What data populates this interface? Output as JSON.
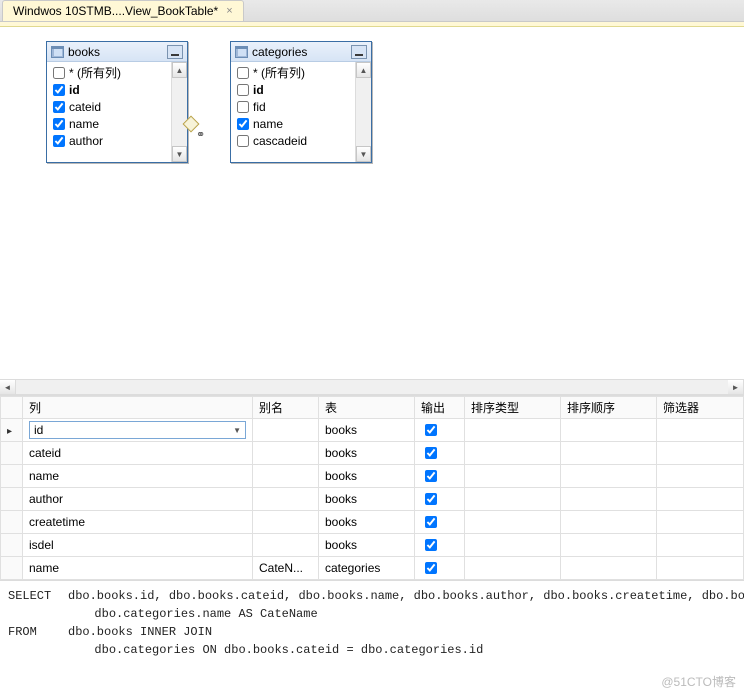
{
  "tab": {
    "label": "Windwos 10STMB....View_BookTable*"
  },
  "tables": {
    "books": {
      "title": "books",
      "all_cols_label": "* (所有列)",
      "columns": [
        {
          "name": "id",
          "checked": true,
          "bold": true
        },
        {
          "name": "cateid",
          "checked": true
        },
        {
          "name": "name",
          "checked": true
        },
        {
          "name": "author",
          "checked": true
        }
      ]
    },
    "categories": {
      "title": "categories",
      "all_cols_label": "* (所有列)",
      "columns": [
        {
          "name": "id",
          "checked": false,
          "bold": true
        },
        {
          "name": "fid",
          "checked": false
        },
        {
          "name": "name",
          "checked": true
        },
        {
          "name": "cascadeid",
          "checked": false
        }
      ]
    }
  },
  "grid": {
    "headers": {
      "col": "列",
      "alias": "别名",
      "table": "表",
      "output": "输出",
      "sort_type": "排序类型",
      "sort_order": "排序顺序",
      "filter": "筛选器"
    },
    "rows": [
      {
        "col": "id",
        "alias": "",
        "table": "books",
        "output": true,
        "active": true
      },
      {
        "col": "cateid",
        "alias": "",
        "table": "books",
        "output": true
      },
      {
        "col": "name",
        "alias": "",
        "table": "books",
        "output": true
      },
      {
        "col": "author",
        "alias": "",
        "table": "books",
        "output": true
      },
      {
        "col": "createtime",
        "alias": "",
        "table": "books",
        "output": true
      },
      {
        "col": "isdel",
        "alias": "",
        "table": "books",
        "output": true
      },
      {
        "col": "name",
        "alias": "CateN...",
        "table": "categories",
        "output": true
      }
    ]
  },
  "sql": {
    "select_kw": "SELECT",
    "select_body": "dbo.books.id, dbo.books.cateid, dbo.books.name, dbo.books.author, dbo.books.createtime, dbo.books.isdel,",
    "select_body2": "dbo.categories.name AS CateName",
    "from_kw": "FROM",
    "from_body": "dbo.books INNER JOIN",
    "from_body2": "dbo.categories ON dbo.books.cateid = dbo.categories.id"
  },
  "watermark": "@51CTO博客"
}
